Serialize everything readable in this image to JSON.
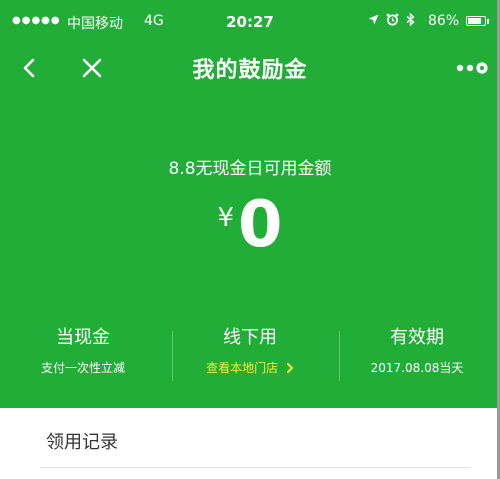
{
  "status_bar": {
    "signal": "●●●●●",
    "carrier": "中国移动",
    "network": "4G",
    "time": "20:27",
    "battery": "86%",
    "battery_level": 0.86,
    "icons": [
      "location-icon",
      "alarm-icon",
      "bluetooth-icon"
    ]
  },
  "nav": {
    "title": "我的鼓励金",
    "back_icon": "chevron-left-icon",
    "close_icon": "close-icon",
    "more_icon": "more-icon"
  },
  "hero": {
    "label": "8.8无现金日可用金额",
    "currency": "¥",
    "amount": "0"
  },
  "columns": [
    {
      "title": "当现金",
      "subtitle": "支付一次性立减"
    },
    {
      "title": "线下用",
      "subtitle": "查看本地门店",
      "subtitle_icon": "chevron-right-icon"
    },
    {
      "title": "有效期",
      "subtitle": "2017.08.08当天"
    }
  ],
  "list": {
    "items": [
      {
        "label": "领用记录"
      }
    ]
  },
  "colors": {
    "brand_green": "#22ad38",
    "link_yellow": "#f2ec3e"
  }
}
